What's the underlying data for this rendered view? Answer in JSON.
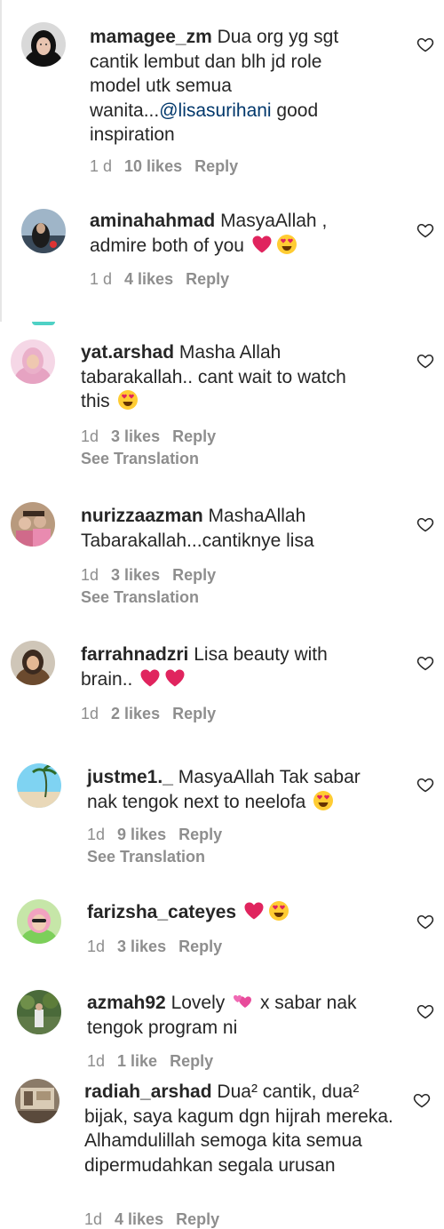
{
  "comments": [
    {
      "username": "mamagee_zm",
      "text_before": "Dua org yg sgt cantik lembut dan blh jd role model utk semua wanita...",
      "mention": "@lisasurihani",
      "text_after": " good inspiration",
      "time": "1 d",
      "likes": "10 likes",
      "reply": "Reply",
      "avatar": "woman-hijab-black-avatar"
    },
    {
      "username": "aminahahmad",
      "text": "MasyaAllah , admire both of you",
      "emojis": [
        "red-heart-emoji",
        "heart-eyes-emoji"
      ],
      "time": "1 d",
      "likes": "4 likes",
      "reply": "Reply",
      "avatar": "dark-photo-avatar"
    },
    {
      "username": "yat.arshad",
      "text": "Masha Allah tabarakallah.. cant wait to watch this",
      "emojis": [
        "heart-eyes-emoji"
      ],
      "time": "1d",
      "likes": "3 likes",
      "reply": "Reply",
      "see_translation": "See Translation",
      "avatar": "pink-hijab-avatar"
    },
    {
      "username": "nurizzaazman",
      "text": "MashaAllah Tabarakallah...cantiknye lisa",
      "time": "1d",
      "likes": "3 likes",
      "reply": "Reply",
      "see_translation": "See Translation",
      "avatar": "family-photo-avatar"
    },
    {
      "username": "farrahnadzri",
      "text": "Lisa beauty with brain..",
      "emojis": [
        "red-heart-emoji",
        "red-heart-emoji"
      ],
      "time": "1d",
      "likes": "2 likes",
      "reply": "Reply",
      "avatar": "woman-portrait-avatar"
    },
    {
      "username": "justme1._",
      "text": "MasyaAllah Tak sabar nak tengok next to neelofa",
      "emojis": [
        "heart-eyes-emoji"
      ],
      "time": "1d",
      "likes": "9 likes",
      "reply": "Reply",
      "see_translation": "See Translation",
      "avatar": "beach-palm-avatar"
    },
    {
      "username": "farizsha_cateyes",
      "text": "",
      "emojis": [
        "red-heart-emoji",
        "heart-eyes-emoji"
      ],
      "time": "1d",
      "likes": "3 likes",
      "reply": "Reply",
      "avatar": "green-pink-avatar"
    },
    {
      "username": "azmah92",
      "text_before": "Lovely",
      "text_after": " x sabar nak tengok program ni",
      "emojis": [
        "two-hearts-emoji"
      ],
      "time": "1d",
      "likes": "1 like",
      "reply": "Reply",
      "avatar": "garden-photo-avatar"
    },
    {
      "username": "radiah_arshad",
      "text": "Dua² cantik, dua² bijak, saya kagum dgn hijrah mereka. Alhamdulillah semoga kita semua dipermudahkan segala urusan",
      "time": "1d",
      "likes": "4 likes",
      "reply": "Reply",
      "avatar": "room-photo-avatar"
    }
  ],
  "colors": {
    "text": "#262626",
    "meta": "#8e8e8e",
    "mention": "#00376b",
    "heart_emoji": "#e0245e"
  }
}
